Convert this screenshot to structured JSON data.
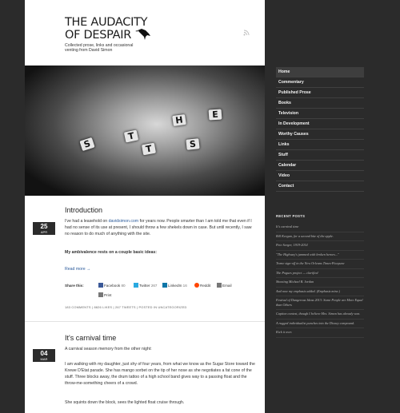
{
  "site": {
    "title_line1": "THE AUDACITY",
    "title_line2": "OF DESPAIR",
    "tagline": "Collected prose, links and occasional venting from David Simon"
  },
  "nav": [
    "Home",
    "Commentary",
    "Published Prose",
    "Books",
    "Television",
    "In Development",
    "Worthy Causes",
    "Links",
    "Stuff",
    "Calendar",
    "Video",
    "Contact"
  ],
  "hero": {
    "keys": [
      "S",
      "T",
      "T",
      "H",
      "S",
      "E"
    ]
  },
  "posts": [
    {
      "date_day": "25",
      "date_month": "APR",
      "title": "Introduction",
      "p1_before": "I've had a leasehold on ",
      "p1_link": "davidsimon.com",
      "p1_after": " for years now.  People smarter than I am told me that even if I had no sense of its use at present, I should throw a few shekels down in case.  But until recently, I saw no reason to do much of anything with the site.",
      "bold_line": "My ambivalence rests on a couple basic ideas:",
      "read_more": "Read more →",
      "share_label": "Share this:",
      "share_buttons": [
        {
          "label": "Facebook",
          "count": "80",
          "color": "#3b5998"
        },
        {
          "label": "Twitter",
          "count": "267",
          "color": "#2aa9e0"
        },
        {
          "label": "LinkedIn",
          "count": "16",
          "color": "#0e76a8"
        },
        {
          "label": "Reddit",
          "count": "",
          "color": "#ff4500"
        },
        {
          "label": "Email",
          "count": "",
          "color": "#777777"
        },
        {
          "label": "Print",
          "count": "",
          "color": "#777777"
        }
      ],
      "meta": "183 COMMENTS  |  8826 LIKES  |  267 TWEETS  |  POSTED IN UNCATEGORIZED"
    },
    {
      "date_day": "04",
      "date_month": "MAR",
      "title": "It's carnival time",
      "p1": "A carnival season memory from the other night:",
      "p2": "I am walking with my daughter, just shy of four years, from what we know as the Sugar Store toward the Krewe D'Etat parade.  She has mango sorbet on the tip of her nose as she negotiates a fat cone of the stuff.  Three blocks away, the drum tattoo of a high school band gives way to a passing float and the throw-me-something cheers of a crowd.",
      "p3": "She squints down the block, sees the lighted float cruise through."
    }
  ],
  "recent": {
    "heading": "RECENT POSTS",
    "items": [
      "It's carnival time",
      "Bill Keegan, for a second bite of the apple.",
      "Pete Seeger, 1919-2014",
      "\"The Highway's jammed with broken heroes...\"",
      "Treme sign-off in the New Orleans Times-Picayune",
      "The Pogues project — clarified",
      "Shooting Michael B. Jordan",
      "And now my emphasis added. (Emphasis mine.)",
      "Festival of Dangerous Ideas 2013: Some People are More Equal than Others",
      "Caption contest, though I believe Mrs. Simon has already won.",
      "A rugged individualist punches into the Disney compound.",
      "Kick it over."
    ]
  }
}
